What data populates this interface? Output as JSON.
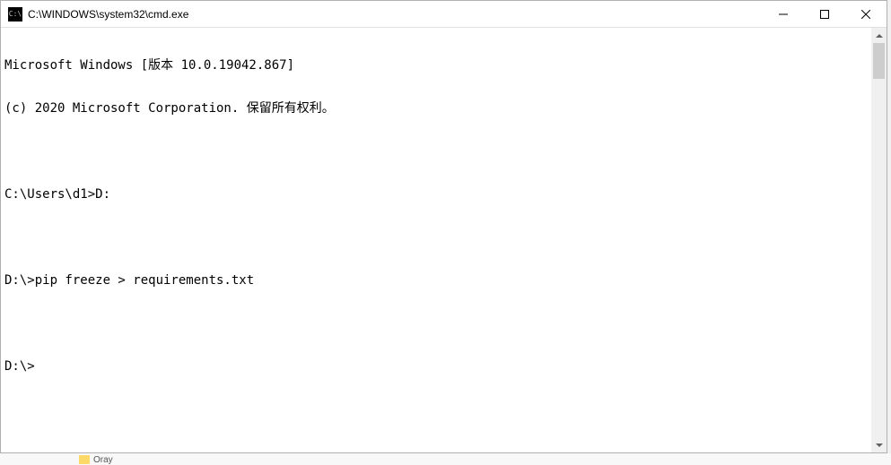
{
  "window": {
    "title": "C:\\WINDOWS\\system32\\cmd.exe",
    "icon_text": "C:\\"
  },
  "terminal": {
    "lines": [
      "Microsoft Windows [版本 10.0.19042.867]",
      "(c) 2020 Microsoft Corporation. 保留所有权利。",
      "",
      "C:\\Users\\d1>D:",
      "",
      "D:\\>pip freeze > requirements.txt",
      "",
      "D:\\>"
    ]
  },
  "taskbar": {
    "partial_folder_label": "Oray"
  }
}
